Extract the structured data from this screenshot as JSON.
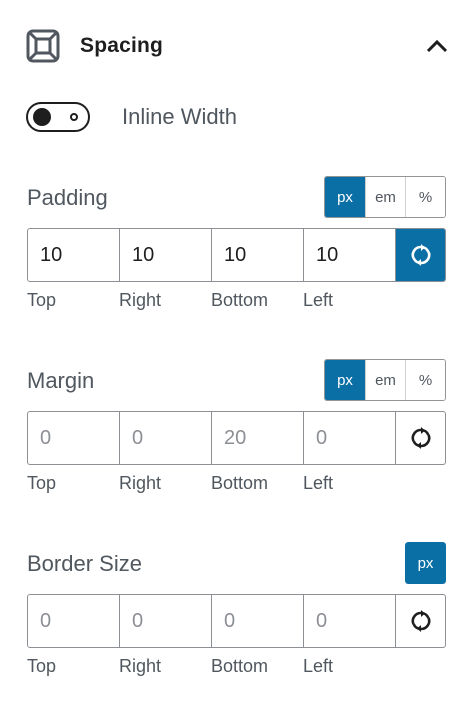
{
  "panel": {
    "title": "Spacing"
  },
  "inline_width": {
    "label": "Inline Width",
    "enabled": false
  },
  "padding": {
    "label": "Padding",
    "units": [
      "px",
      "em",
      "%"
    ],
    "active_unit": "px",
    "values": [
      "10",
      "10",
      "10",
      "10"
    ],
    "sides": [
      "Top",
      "Right",
      "Bottom",
      "Left"
    ],
    "linked": true
  },
  "margin": {
    "label": "Margin",
    "units": [
      "px",
      "em",
      "%"
    ],
    "active_unit": "px",
    "placeholders": [
      "0",
      "0",
      "20",
      "0"
    ],
    "sides": [
      "Top",
      "Right",
      "Bottom",
      "Left"
    ],
    "linked": false
  },
  "border_size": {
    "label": "Border Size",
    "units": [
      "px"
    ],
    "active_unit": "px",
    "placeholders": [
      "0",
      "0",
      "0",
      "0"
    ],
    "sides": [
      "Top",
      "Right",
      "Bottom",
      "Left"
    ],
    "linked": false
  },
  "colors": {
    "accent": "#0a6fa5",
    "text": "#1e1e1e",
    "muted": "#50575e",
    "border": "#8c8f94"
  }
}
